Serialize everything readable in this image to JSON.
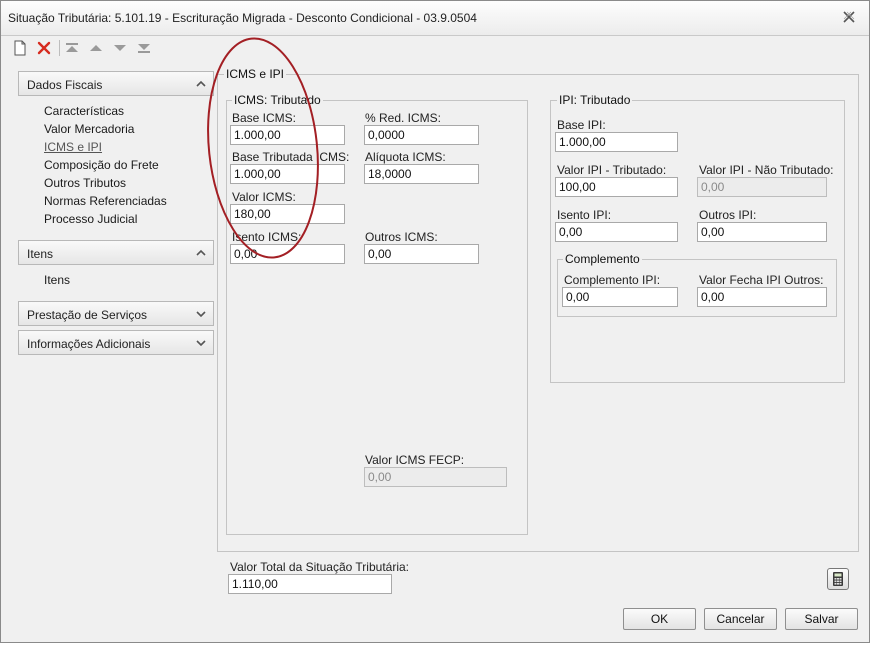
{
  "window": {
    "title": "Situação Tributária: 5.101.19 - Escrituração Migrada - Desconto Condicional - 03.9.0504"
  },
  "toolbar": {
    "buttons": [
      "new-document",
      "delete",
      "move-first",
      "move-up",
      "move-down",
      "move-last"
    ]
  },
  "nav": {
    "sections": [
      {
        "label": "Dados Fiscais",
        "expanded": true,
        "items": [
          "Características",
          "Valor Mercadoria",
          "ICMS e IPI",
          "Composição do Frete",
          "Outros Tributos",
          "Normas Referenciadas",
          "Processo Judicial"
        ],
        "active_item": "ICMS e IPI"
      },
      {
        "label": "Itens",
        "expanded": true,
        "items": [
          "Itens"
        ]
      },
      {
        "label": "Prestação de Serviços",
        "expanded": false,
        "items": []
      },
      {
        "label": "Informações Adicionais",
        "expanded": false,
        "items": []
      }
    ]
  },
  "main": {
    "section_title": "ICMS e IPI",
    "icms": {
      "group_title": "ICMS: Tributado",
      "base_icms": {
        "label": "Base ICMS:",
        "value": "1.000,00"
      },
      "red_icms": {
        "label": "% Red. ICMS:",
        "value": "0,0000"
      },
      "base_tributada": {
        "label": "Base Tributada ICMS:",
        "value": "1.000,00"
      },
      "aliquota": {
        "label": "Alíquota ICMS:",
        "value": "18,0000"
      },
      "valor_icms": {
        "label": "Valor ICMS:",
        "value": "180,00"
      },
      "isento": {
        "label": "Isento ICMS:",
        "value": "0,00"
      },
      "outros": {
        "label": "Outros ICMS:",
        "value": "0,00"
      },
      "fecp": {
        "label": "Valor ICMS FECP:",
        "value": "0,00"
      }
    },
    "ipi": {
      "group_title": "IPI: Tributado",
      "base_ipi": {
        "label": "Base IPI:",
        "value": "1.000,00"
      },
      "valor_tributado": {
        "label": "Valor IPI - Tributado:",
        "value": "100,00"
      },
      "valor_nao_tributado": {
        "label": "Valor IPI - Não Tributado:",
        "value": "0,00"
      },
      "isento": {
        "label": "Isento IPI:",
        "value": "0,00"
      },
      "outros": {
        "label": "Outros IPI:",
        "value": "0,00"
      },
      "complemento": {
        "group_title": "Complemento",
        "complemento_ipi": {
          "label": "Complemento IPI:",
          "value": "0,00"
        },
        "fecha_outros": {
          "label": "Valor Fecha IPI Outros:",
          "value": "0,00"
        }
      }
    }
  },
  "footer": {
    "total": {
      "label": "Valor Total da Situação Tributária:",
      "value": "1.110,00"
    },
    "buttons": {
      "ok": "OK",
      "cancel": "Cancelar",
      "save": "Salvar"
    }
  },
  "colors": {
    "window_bg": "#f0f0f0",
    "annotation_ellipse": "#a31f24",
    "delete_icon": "#d62b1f"
  }
}
